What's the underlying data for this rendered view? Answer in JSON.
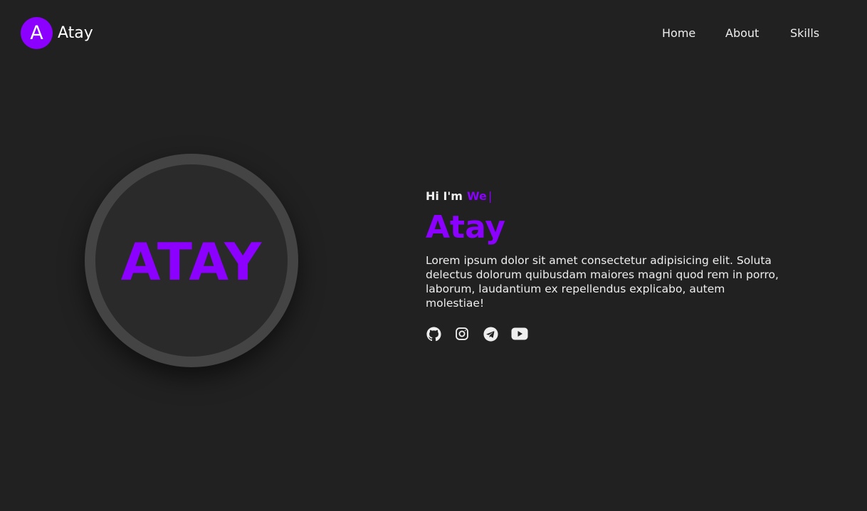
{
  "brand": {
    "logo_letter": "A",
    "name": "Atay"
  },
  "nav": {
    "items": [
      {
        "label": "Home"
      },
      {
        "label": "About"
      },
      {
        "label": "Skills"
      }
    ]
  },
  "avatar": {
    "text": "ATAY"
  },
  "hero": {
    "greeting_static": "Hi I'm",
    "greeting_typed": "We",
    "cursor": "|",
    "name": "Atay",
    "description": "Lorem ipsum dolor sit amet consectetur adipisicing elit. Soluta delectus dolorum quibusdam maiores magni quod rem in porro, laborum, laudantium ex repellendus explicabo, autem molestiae!"
  },
  "socials": [
    {
      "icon": "github-icon"
    },
    {
      "icon": "instagram-icon"
    },
    {
      "icon": "telegram-icon"
    },
    {
      "icon": "youtube-icon"
    }
  ],
  "colors": {
    "accent": "#8b00ff",
    "background": "#212121",
    "ring": "#444444",
    "text": "#eeeeee"
  }
}
